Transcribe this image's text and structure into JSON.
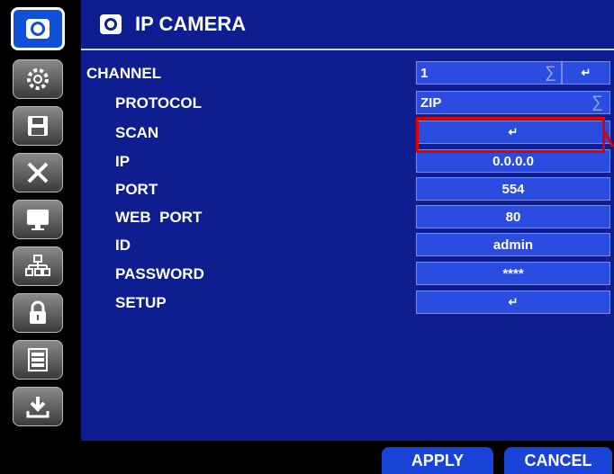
{
  "header": {
    "title": "IP CAMERA"
  },
  "fields": {
    "channel": {
      "label": "CHANNEL",
      "value": "1",
      "selector": "∑",
      "enter": "↵"
    },
    "protocol": {
      "label": "PROTOCOL",
      "value": "ZIP",
      "selector": "∑"
    },
    "scan": {
      "label": "SCAN",
      "enter": "↵"
    },
    "ip": {
      "label": "IP",
      "value": "0.0.0.0"
    },
    "port": {
      "label": "PORT",
      "value": "554"
    },
    "web_port": {
      "label": "WEB  PORT",
      "value": "80"
    },
    "id": {
      "label": "ID",
      "value": "admin"
    },
    "password": {
      "label": "PASSWORD",
      "value": "****"
    },
    "setup": {
      "label": "SETUP",
      "enter": "↵"
    }
  },
  "footer": {
    "apply": "APPLY",
    "cancel": "CANCEL"
  },
  "colors": {
    "accent": "#1050d8",
    "panel": "#0e1e90",
    "field": "#2a4ce0",
    "highlight": "#e00000"
  }
}
